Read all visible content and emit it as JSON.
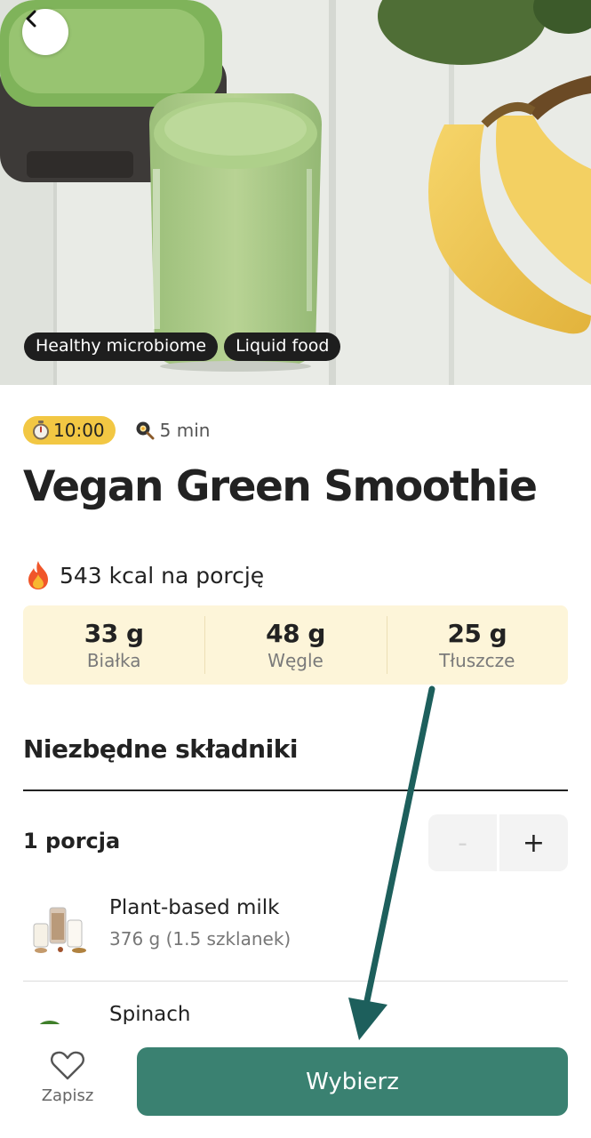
{
  "hero": {
    "tags": [
      "Healthy microbiome",
      "Liquid food"
    ]
  },
  "meta": {
    "timer": "10:00",
    "prep_time": "5 min"
  },
  "recipe": {
    "title": "Vegan Green Smoothie",
    "calories": "543 kcal na porcję"
  },
  "macros": [
    {
      "value": "33 g",
      "label": "Białka"
    },
    {
      "value": "48 g",
      "label": "Węgle"
    },
    {
      "value": "25 g",
      "label": "Tłuszcze"
    }
  ],
  "ingredients_section": {
    "title": "Niezbędne składniki",
    "portion_label": "1 porcja",
    "minus_label": "-",
    "plus_label": "+",
    "items": [
      {
        "name": "Plant-based milk",
        "amount": "376 g (1.5 szklanek)"
      },
      {
        "name": "Spinach",
        "amount": ""
      }
    ]
  },
  "bottom_bar": {
    "save_label": "Zapisz",
    "choose_label": "Wybierz"
  },
  "colors": {
    "accent": "#3a8171",
    "timer_badge": "#f2c743",
    "macros_bg": "#fdf5d9",
    "annotation_arrow": "#1d5f5c"
  },
  "icons": [
    "back-arrow-icon",
    "stopwatch-icon",
    "frying-pan-icon",
    "fire-icon",
    "heart-icon"
  ]
}
